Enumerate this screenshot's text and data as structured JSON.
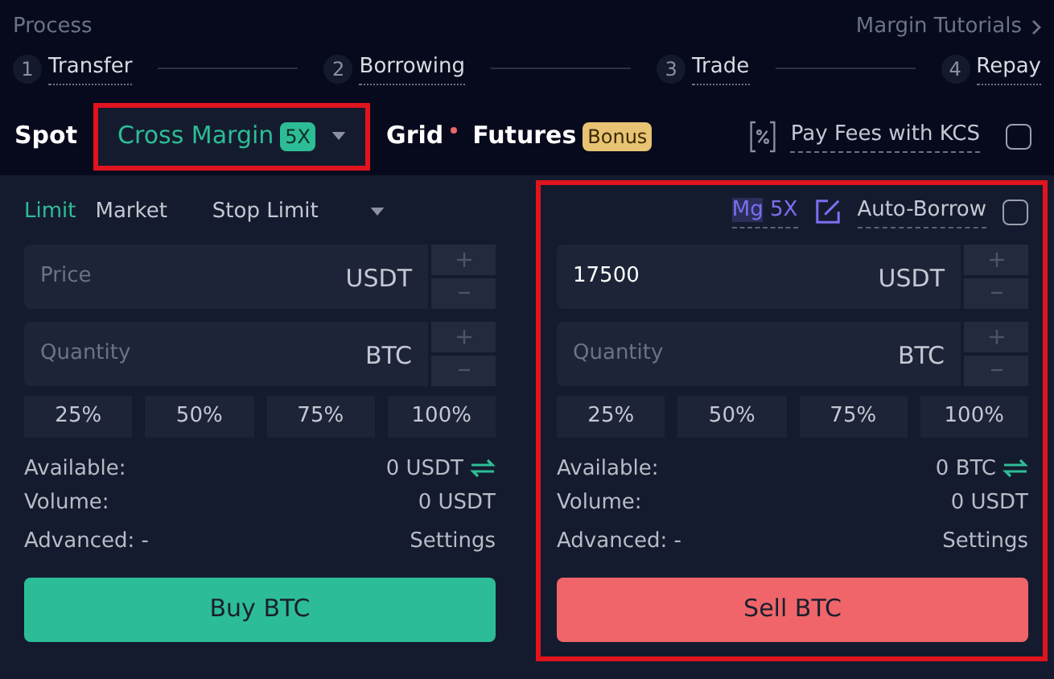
{
  "process": {
    "title": "Process",
    "link": "Margin Tutorials",
    "steps": [
      {
        "number": "1",
        "label": "Transfer"
      },
      {
        "number": "2",
        "label": "Borrowing"
      },
      {
        "number": "3",
        "label": "Trade"
      },
      {
        "number": "4",
        "label": "Repay"
      }
    ]
  },
  "tabs": [
    {
      "label": "Spot",
      "selected": false
    },
    {
      "label": "Cross Margin",
      "badge": "5X",
      "selected": true,
      "highlighted": true,
      "dropdown": true
    },
    {
      "label": "Grid",
      "selected": false,
      "dot": true
    },
    {
      "label": "Futures",
      "badge": "Bonus",
      "selected": false
    }
  ],
  "pay_fees": {
    "label": "Pay Fees with KCS",
    "checked": false
  },
  "order_types": [
    {
      "label": "Limit",
      "selected": true
    },
    {
      "label": "Market",
      "selected": false
    },
    {
      "label": "Stop Limit",
      "selected": false
    }
  ],
  "panels": [
    {
      "kind": "buy",
      "price": {
        "placeholder": "Price",
        "unit": "USDT"
      },
      "quantity": {
        "placeholder": "Quantity",
        "unit": "BTC"
      },
      "percents": [
        "25%",
        "50%",
        "75%",
        "100%"
      ],
      "available": {
        "label": "Available:",
        "value": "0 USDT"
      },
      "volume": {
        "label": "Volume:",
        "value": "0 USDT"
      },
      "advanced": {
        "label": "Advanced: -",
        "link": "Settings"
      },
      "action": "Buy BTC"
    },
    {
      "kind": "sell",
      "highlighted": true,
      "margin": {
        "tag": "Mg",
        "leverage": "5X",
        "auto_borrow": "Auto-Borrow",
        "checked": false
      },
      "price": {
        "value": "17500",
        "unit": "USDT"
      },
      "quantity": {
        "placeholder": "Quantity",
        "unit": "BTC"
      },
      "percents": [
        "25%",
        "50%",
        "75%",
        "100%"
      ],
      "available": {
        "label": "Available:",
        "value": "0 BTC"
      },
      "volume": {
        "label": "Volume:",
        "value": "0 USDT"
      },
      "advanced": {
        "label": "Advanced: -",
        "link": "Settings"
      },
      "action": "Sell BTC"
    }
  ]
}
